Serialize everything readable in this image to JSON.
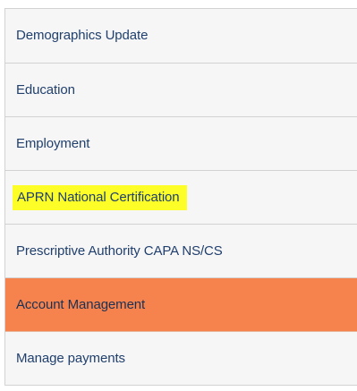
{
  "sidebar": {
    "items": [
      {
        "label": "Demographics Update",
        "active": false,
        "highlighted": false
      },
      {
        "label": "Education",
        "active": false,
        "highlighted": false
      },
      {
        "label": "Employment",
        "active": false,
        "highlighted": false
      },
      {
        "label": "APRN National Certification",
        "active": false,
        "highlighted": true
      },
      {
        "label": "Prescriptive Authority CAPA NS/CS",
        "active": false,
        "highlighted": false
      },
      {
        "label": "Account Management",
        "active": true,
        "highlighted": false
      },
      {
        "label": "Manage payments",
        "active": false,
        "highlighted": false
      }
    ]
  },
  "colors": {
    "item_background": "#f6f6f6",
    "active_background": "#f6834e",
    "highlight": "#fdfd27",
    "link_text": "#21406e",
    "border": "#d2d2d2"
  }
}
